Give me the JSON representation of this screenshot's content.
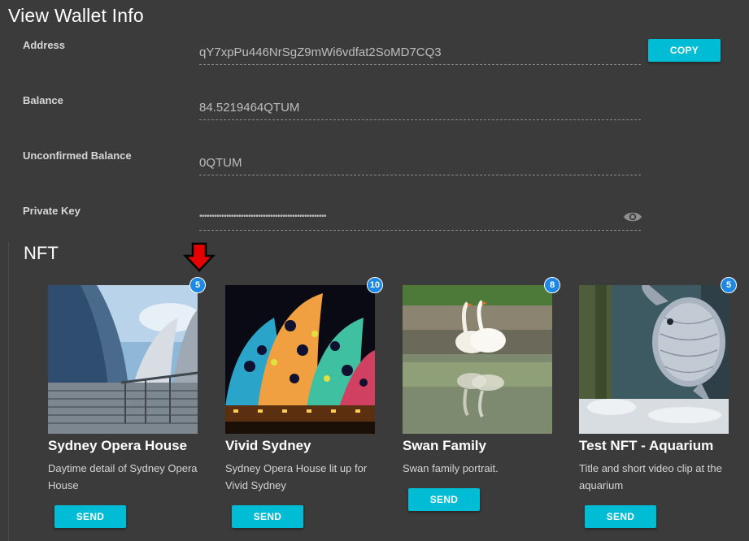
{
  "page": {
    "title": "View Wallet Info"
  },
  "fields": {
    "address": {
      "label": "Address",
      "value": "qY7xpPu446NrSgZ9mWi6vdfat2SoMD7CQ3"
    },
    "balance": {
      "label": "Balance",
      "value": "84.5219464QTUM"
    },
    "unconfirmed": {
      "label": "Unconfirmed Balance",
      "value": "0QTUM"
    },
    "private_key": {
      "label": "Private Key",
      "value": "••••••••••••••••••••••••••••••••••••••••••••••••••••"
    }
  },
  "copy_label": "COPY",
  "icons": {
    "reveal": "eye-icon",
    "pointer": "red-down-arrow-icon"
  },
  "colors": {
    "accent": "#00bcd4",
    "badge": "#1e88e5",
    "background": "#3b3b3b",
    "arrow": "#e60000"
  },
  "nft": {
    "title": "NFT",
    "send_label": "SEND",
    "items": [
      {
        "name": "Sydney Opera House",
        "count": "5",
        "description": "Daytime detail of Sydney Opera House"
      },
      {
        "name": "Vivid Sydney",
        "count": "10",
        "description": "Sydney Opera House lit up for Vivid Sydney"
      },
      {
        "name": "Swan Family",
        "count": "8",
        "description": "Swan family portrait."
      },
      {
        "name": "Test NFT - Aquarium",
        "count": "5",
        "description": "Title and short video clip at the aquarium"
      }
    ]
  }
}
